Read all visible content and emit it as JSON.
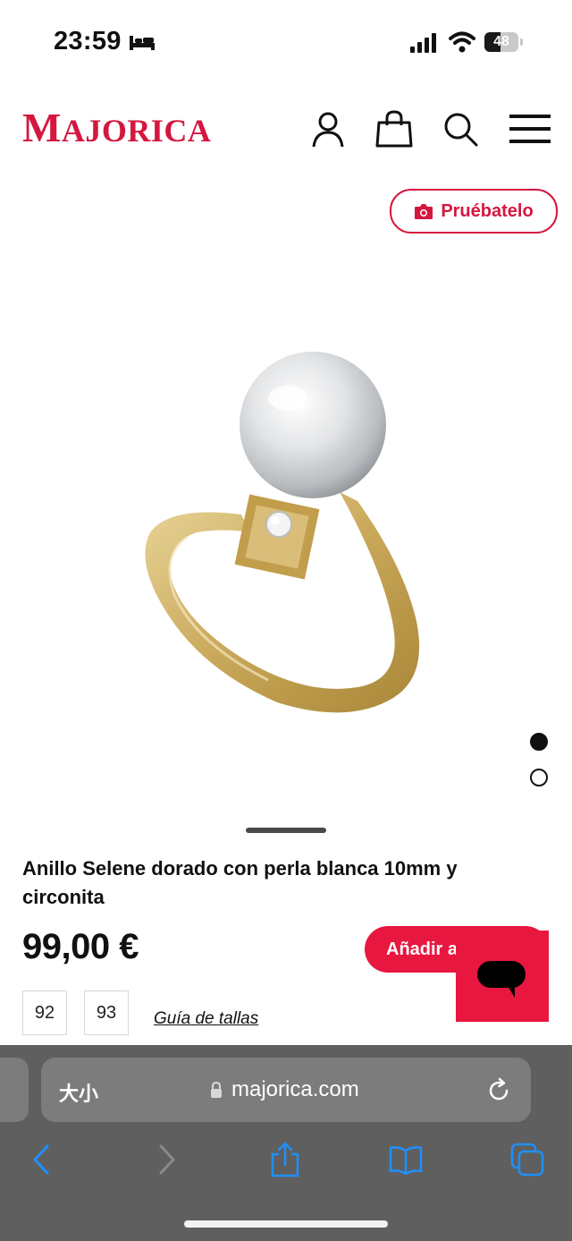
{
  "status_bar": {
    "time": "23:59",
    "battery": "48",
    "battery_level": 0.48,
    "icons": [
      "bed-icon",
      "cellular-signal-icon",
      "wifi-icon",
      "battery-icon"
    ]
  },
  "header": {
    "logo": "MAJORICA",
    "icons": [
      "account-icon",
      "shopping-bag-icon",
      "search-icon",
      "menu-icon"
    ]
  },
  "try_on": {
    "label": "Pruébatelo",
    "icon": "camera-icon"
  },
  "gallery": {
    "image_count": 2,
    "active_index": 0
  },
  "product": {
    "title": "Anillo Selene dorado con perla blanca 10mm y circonita",
    "price": "99,00 €",
    "add_to_cart_label": "Añadir a",
    "sizes": [
      "92",
      "93"
    ],
    "size_guide_label": "Guía de tallas"
  },
  "browser": {
    "text_size_label": "大小",
    "url": "majorica.com",
    "toolbar": [
      "back-icon",
      "forward-icon",
      "share-icon",
      "bookmarks-icon",
      "tabs-icon"
    ]
  },
  "colors": {
    "brand": "#d5173f",
    "button": "#e8173f",
    "chrome": "#5f5f5f"
  }
}
